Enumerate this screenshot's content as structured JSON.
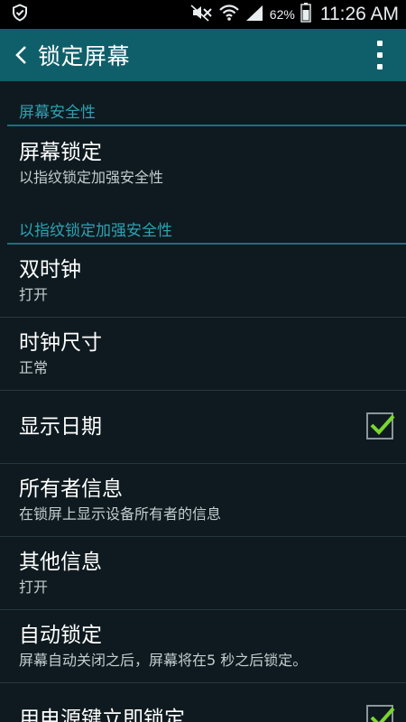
{
  "status_bar": {
    "battery_percent": "62%",
    "time": "11:26 AM"
  },
  "action_bar": {
    "title": "锁定屏幕"
  },
  "sections": [
    {
      "header": "屏幕安全性",
      "items": [
        {
          "title": "屏幕锁定",
          "subtitle": "以指纹锁定加强安全性"
        }
      ]
    },
    {
      "header": "以指纹锁定加强安全性",
      "items": [
        {
          "title": "双时钟",
          "subtitle": "打开"
        },
        {
          "title": "时钟尺寸",
          "subtitle": "正常"
        },
        {
          "title": "显示日期",
          "checked": true
        },
        {
          "title": "所有者信息",
          "subtitle": "在锁屏上显示设备所有者的信息"
        },
        {
          "title": "其他信息",
          "subtitle": "打开"
        },
        {
          "title": "自动锁定",
          "subtitle": "屏幕自动关闭之后，屏幕将在5 秒之后锁定。"
        },
        {
          "title": "用电源键立即锁定",
          "checked": true
        }
      ]
    }
  ],
  "colors": {
    "action_bar": "#0f5f6a",
    "background": "#0e1a1f",
    "section_header": "#2fa0b3",
    "check": "#7bd531"
  }
}
